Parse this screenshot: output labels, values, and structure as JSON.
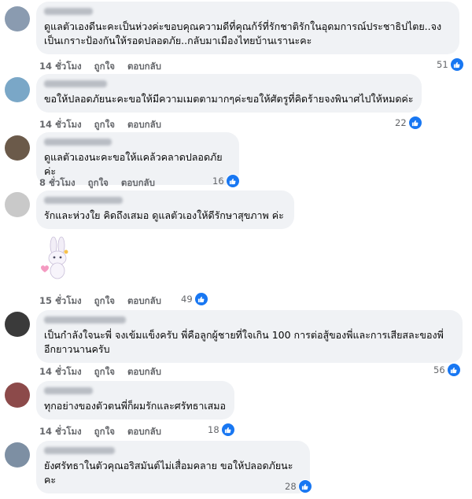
{
  "comments": [
    {
      "text": "ดูแลตัวเองดีนะคะเป็นห่วงค่ะขอบคุณความดีที่คุณก้ร์ที่รักชาติรักในอุดมการณ์ประชาธิปไตย..จง\nเป็นเกราะป้องกันให้รอดปลอดภัย..กลับมาเมืองไทยบ้านเรานะคะ",
      "time": "14 ชั่วโมง",
      "like": "ถูกใจ",
      "reply": "ตอบกลับ",
      "count": "51",
      "avatar_color": "#8a9bb0"
    },
    {
      "text": "ขอให้ปลอดภัยนะคะขอให้มีความเมตตามากๆค่ะขอให้ศัตรูที่คิดร้ายจงพินาศไปให้หมดค่ะ",
      "time": "14 ชั่วโมง",
      "like": "ถูกใจ",
      "reply": "ตอบกลับ",
      "count": "22",
      "avatar_color": "#7aa7c7"
    },
    {
      "text": "ดูแลตัวเองนะคะขอให้แคล้วคลาดปลอดภัยค่ะ",
      "time": "8 ชั่วโมง",
      "like": "ถูกใจ",
      "reply": "ตอบกลับ",
      "count": "16",
      "avatar_color": "#6b5a4a"
    },
    {
      "text": "รักและห่วงใย คิดถึงเสมอ ดูแลตัวเองให้ดีรักษาสุขภาพ ค่ะ",
      "time": "15 ชั่วโมง",
      "like": "ถูกใจ",
      "reply": "ตอบกลับ",
      "count": "49",
      "avatar_color": "#c9c9c9"
    },
    {
      "text": "เป็นกำลังใจนะพี่ จงเข้มแข็งครับ พี่คือลูกผู้ชายที่ใจเกิน 100 การต่อสู้ของพี่และการเสียสละของพี่\nอีกยาวนานครับ",
      "time": "14 ชั่วโมง",
      "like": "ถูกใจ",
      "reply": "ตอบกลับ",
      "count": "56",
      "avatar_color": "#3a3a3a"
    },
    {
      "text": "ทุกอย่างของตัวตนพี่ก็ผมรักและศรัทธาเสมอ",
      "time": "14 ชั่วโมง",
      "like": "ถูกใจ",
      "reply": "ตอบกลับ",
      "count": "18",
      "avatar_color": "#8c4a4a"
    },
    {
      "text": "ยังศรัทธาในตัวคุณอริสมันต์ไม่เสื่อมคลาย ขอให้ปลอดภัยนะคะ",
      "time": "14 ชั่วโมง",
      "like": "ถูกใจ",
      "reply": "ตอบกลับ",
      "count": "28",
      "avatar_color": "#7d8fa3"
    }
  ]
}
